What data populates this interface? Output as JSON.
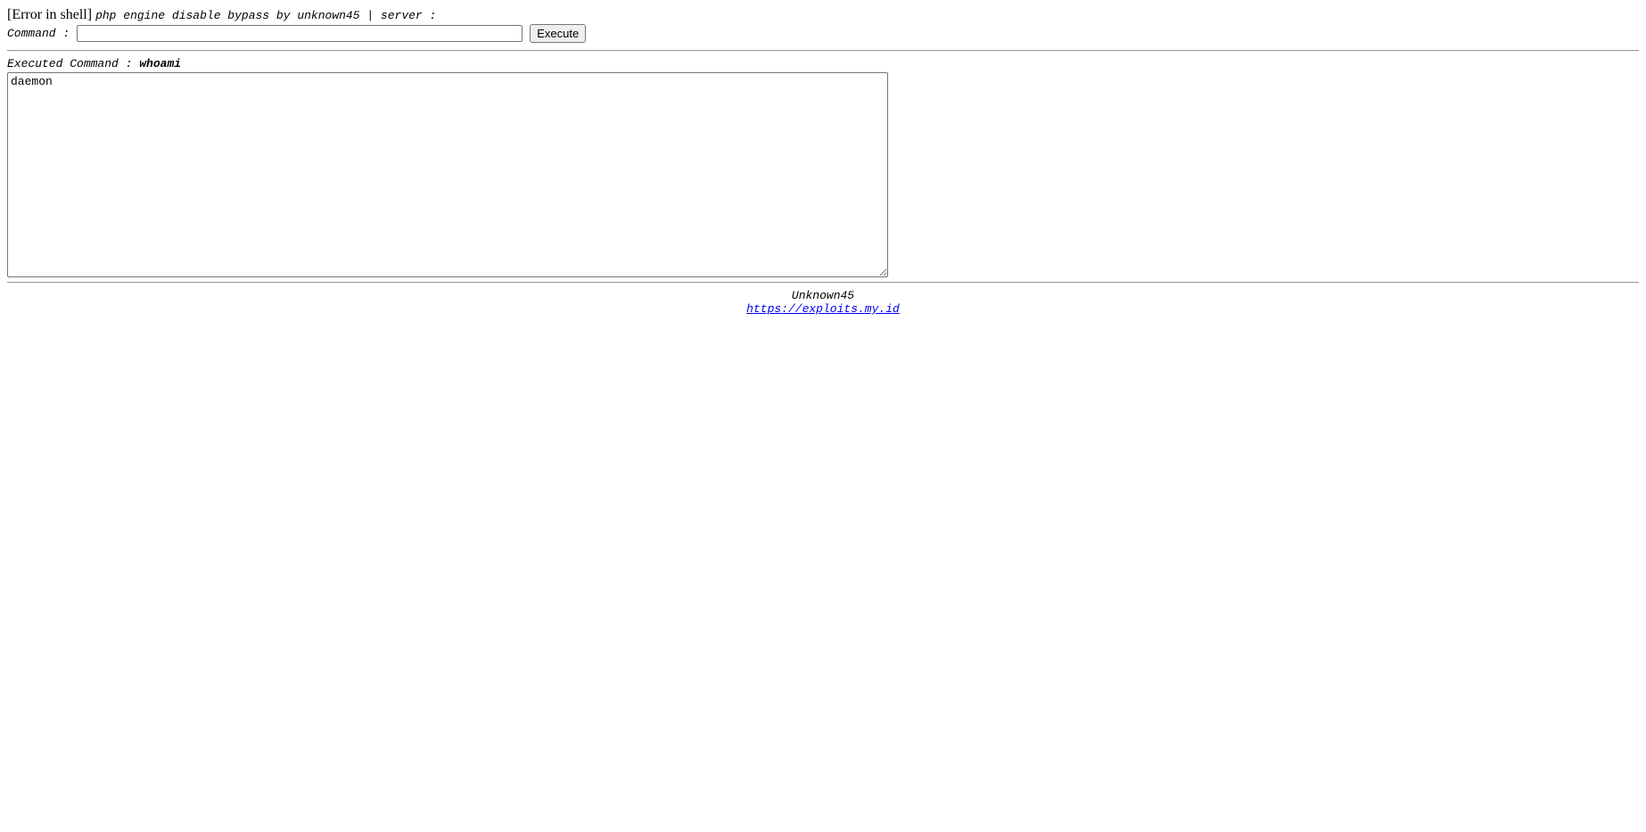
{
  "header": {
    "error_text": "[Error in shell]",
    "subtitle": "php engine disable bypass by unknown45 | server :"
  },
  "form": {
    "command_label": "Command :",
    "command_value": "",
    "execute_label": "Execute"
  },
  "result": {
    "executed_label": "Executed Command :",
    "executed_command": "whoami",
    "output": "daemon"
  },
  "footer": {
    "author": "Unknown45",
    "link_text": "https://exploits.my.id"
  },
  "colors": {
    "link": "#0000ee",
    "text": "#000000",
    "background": "#ffffff"
  }
}
